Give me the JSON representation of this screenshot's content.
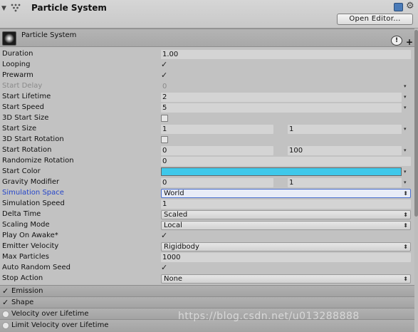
{
  "header": {
    "title": "Particle System",
    "open_editor_label": "Open Editor...",
    "icons": [
      "foldout-arrow-icon",
      "particle-system-icon",
      "help-book-icon",
      "gear-icon"
    ]
  },
  "module": {
    "title": "Particle System",
    "info_glyph": "!",
    "plus_glyph": "+"
  },
  "properties": {
    "duration": {
      "label": "Duration",
      "value": "1.00"
    },
    "looping": {
      "label": "Looping",
      "checked": true
    },
    "prewarm": {
      "label": "Prewarm",
      "checked": true
    },
    "start_delay": {
      "label": "Start Delay",
      "value": "0"
    },
    "start_lifetime": {
      "label": "Start Lifetime",
      "value": "2"
    },
    "start_speed": {
      "label": "Start Speed",
      "value": "5"
    },
    "three_d_start_size": {
      "label": "3D Start Size",
      "checked": false
    },
    "start_size": {
      "label": "Start Size",
      "value_a": "1",
      "value_b": "1"
    },
    "three_d_start_rotation": {
      "label": "3D Start Rotation",
      "checked": false
    },
    "start_rotation": {
      "label": "Start Rotation",
      "value_a": "0",
      "value_b": "100"
    },
    "randomize_rotation": {
      "label": "Randomize Rotation",
      "value": "0"
    },
    "start_color": {
      "label": "Start Color",
      "color": "#3fc8ea"
    },
    "gravity_modifier": {
      "label": "Gravity Modifier",
      "value_a": "0",
      "value_b": "1"
    },
    "simulation_space": {
      "label": "Simulation Space",
      "value": "World"
    },
    "simulation_speed": {
      "label": "Simulation Speed",
      "value": "1"
    },
    "delta_time": {
      "label": "Delta Time",
      "value": "Scaled"
    },
    "scaling_mode": {
      "label": "Scaling Mode",
      "value": "Local"
    },
    "play_on_awake": {
      "label": "Play On Awake*",
      "checked": true
    },
    "emitter_velocity": {
      "label": "Emitter Velocity",
      "value": "Rigidbody"
    },
    "max_particles": {
      "label": "Max Particles",
      "value": "1000"
    },
    "auto_random_seed": {
      "label": "Auto Random Seed",
      "checked": true
    },
    "stop_action": {
      "label": "Stop Action",
      "value": "None"
    }
  },
  "sections": [
    {
      "title": "Emission",
      "enabled": true
    },
    {
      "title": "Shape",
      "enabled": true
    },
    {
      "title": "Velocity over Lifetime",
      "enabled": false
    },
    {
      "title": "Limit Velocity over Lifetime",
      "enabled": false
    }
  ],
  "glyphs": {
    "check": "✓",
    "dropdown_arrow": "▾",
    "popup_arrow": "⬍"
  },
  "watermark": "https://blog.csdn.net/u013288888",
  "colors": {
    "accent_blue": "#2545c9",
    "start_color": "#3fc8ea",
    "panel_bg": "#c2c2c2"
  }
}
